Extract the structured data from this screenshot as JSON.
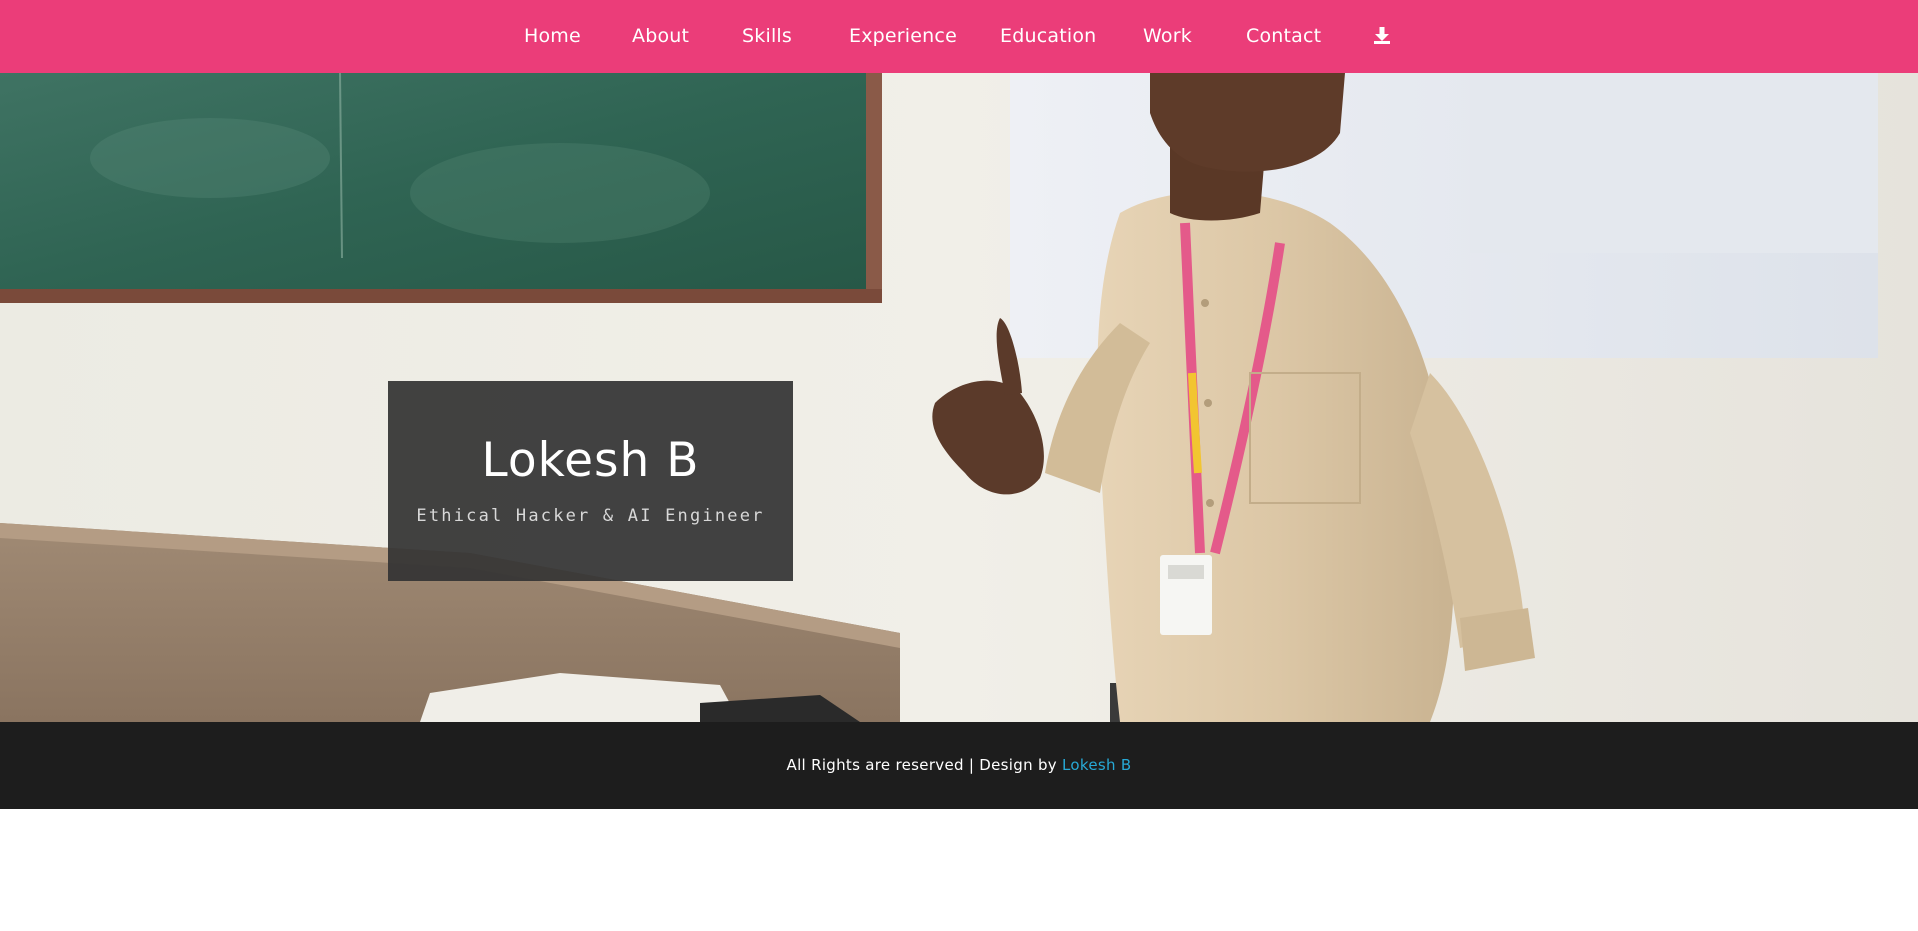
{
  "nav": {
    "items": [
      {
        "label": "Home"
      },
      {
        "label": "About"
      },
      {
        "label": "Skills"
      },
      {
        "label": "Experience"
      },
      {
        "label": "Education"
      },
      {
        "label": "Work"
      },
      {
        "label": "Contact"
      }
    ],
    "download_icon": "download-icon",
    "background_color": "#eb3d79"
  },
  "hero": {
    "name": "Lokesh B",
    "role": "Ethical Hacker & AI Engineer",
    "background_image": "photo of person presenting in a classroom"
  },
  "footer": {
    "text": "All Rights are reserved | Design by ",
    "link_label": "Lokesh B",
    "link_color": "#27a9d6",
    "background_color": "#1d1d1d"
  }
}
